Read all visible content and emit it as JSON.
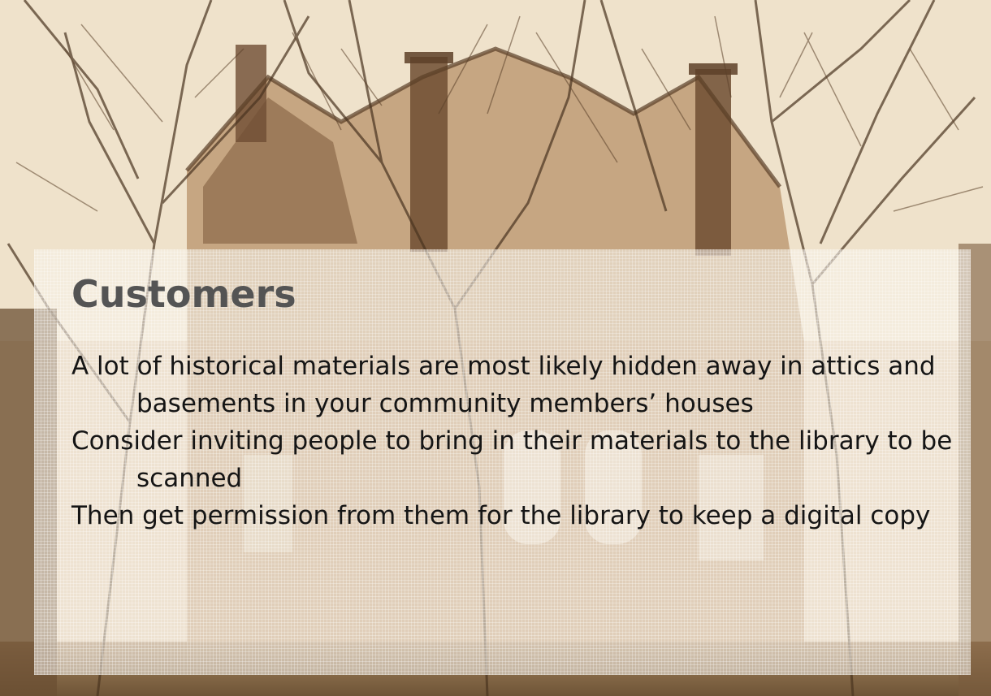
{
  "slide": {
    "title": "Customers",
    "bullets": [
      "A lot of historical materials are most likely hidden away in attics and basements in your community members’ houses",
      "Consider inviting people to bring in their materials to the library to be scanned",
      "Then get permission from them for the library to keep a digital copy"
    ]
  },
  "colors": {
    "title": "#545454",
    "body_text": "#151515",
    "photo_tone": "#c9ac86"
  }
}
